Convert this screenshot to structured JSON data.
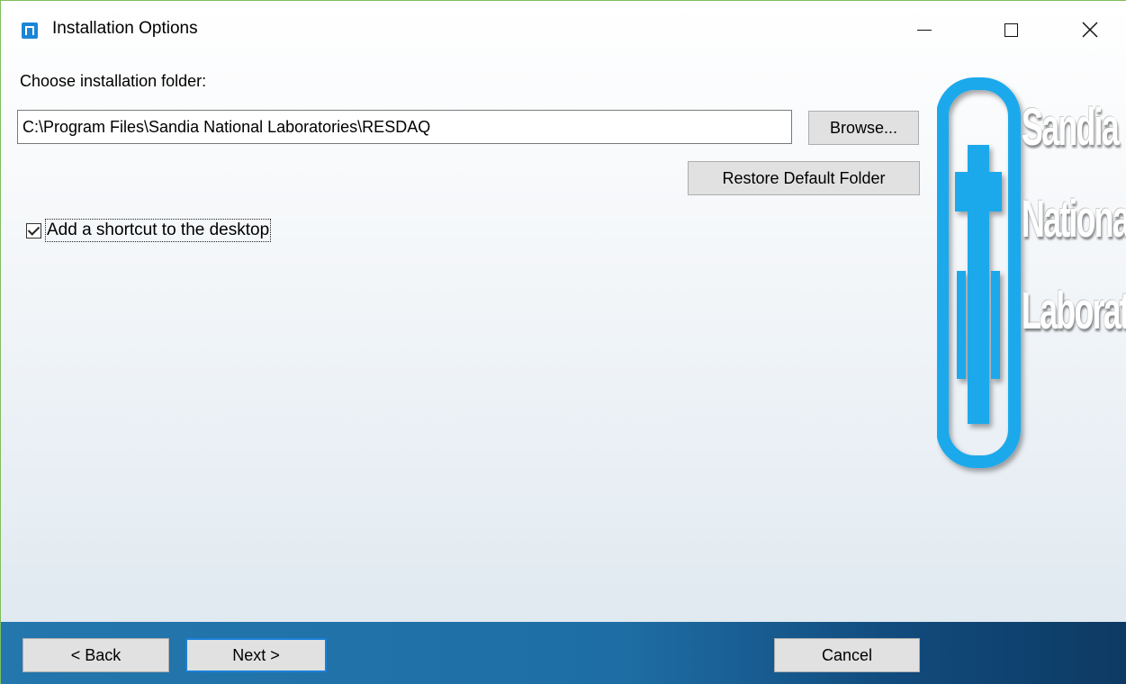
{
  "window": {
    "title": "Installation Options",
    "controls": [
      "minimize",
      "maximize",
      "close"
    ]
  },
  "folder": {
    "label": "Choose installation folder:",
    "path": "C:\\Program Files\\Sandia National Laboratories\\RESDAQ",
    "browse_label": "Browse...",
    "restore_label": "Restore Default Folder"
  },
  "shortcut": {
    "label": "Add a shortcut to the desktop",
    "checked": true
  },
  "logo": {
    "text_lines": [
      "Sandia",
      "National",
      "Laboratories"
    ],
    "accent_color": "#1ea9ec"
  },
  "footer": {
    "back_label": "< Back",
    "next_label": "Next >",
    "cancel_label": "Cancel"
  }
}
